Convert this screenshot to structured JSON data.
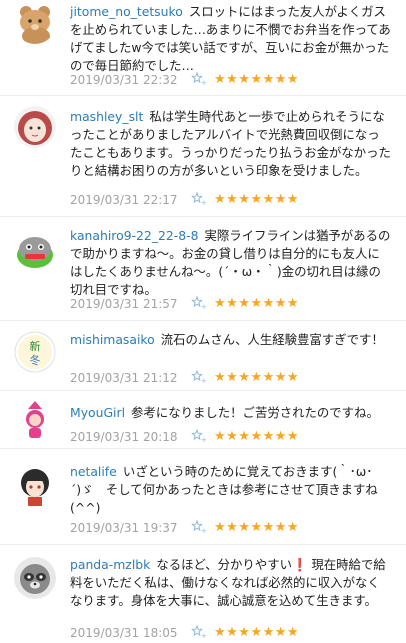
{
  "comments": [
    {
      "user": "jitome_no_tetsuko",
      "text": "スロットにはまった友人がよくガスを止められていました…あまりに不憫でお弁当を作ってあげてましたw今では笑い話ですが、互いにお金が無かったので毎日節約でした…",
      "date": "2019/03/31 22:32",
      "stars": "★★★★★★★",
      "avatar": "bear-avatar"
    },
    {
      "user": "mashley_slt",
      "text": "私は学生時代あと一歩で止められそうになったことがありましたアルバイトで光熱費回収倒になったこともあります。うっかりだったり払うお金がなかったりと結構お困りの方が多いという印象を受けました。",
      "date": "2019/03/31 22:17",
      "stars": "★★★★★★★",
      "avatar": "red-hair-avatar"
    },
    {
      "user": "kanahiro9-22_22-8-8",
      "text": "実際ライフラインは猶予があるので助かりますね～。お金の貸し借りは自分的にも友人にはしたくありませんね～。(´・ω・｀)金の切れ目は縁の切れ目ですね。",
      "date": "2019/03/31 21:57",
      "stars": "★★★★★★★",
      "avatar": "green-creature-avatar"
    },
    {
      "user": "mishimasaiko",
      "text": "流石のムさん、人生経験豊富すぎです！",
      "date": "2019/03/31 21:12",
      "stars": "★★★★★★★",
      "avatar": "new-winter-avatar"
    },
    {
      "user": "MyouGirl",
      "text": "参考になりました！ご苦労されたのですね。",
      "date": "2019/03/31 20:18",
      "stars": "★★★★★★★",
      "avatar": "pink-girl-avatar"
    },
    {
      "user": "netalife",
      "text": "いざという時のために覚えておきます(｀･ω･´)ゞ　そして何かあったときは参考にさせて頂きますね(^^)",
      "date": "2019/03/31 19:37",
      "stars": "★★★★★★★",
      "avatar": "anime-girl-avatar"
    },
    {
      "user": "panda-mzlbk",
      "text": "なるほど、分かりやすい❗ 現在時給で給料をいただく私は、働けなくなれば必然的に収入がなくなります。身体を大事に、誠心誠意を込めて生きます。",
      "date": "2019/03/31 18:05",
      "stars": "★★★★★★★",
      "avatar": "raccoon-avatar"
    }
  ],
  "colors": {
    "username": "#2a7db8",
    "star": "#f5a623",
    "date": "#a3a3a3"
  }
}
